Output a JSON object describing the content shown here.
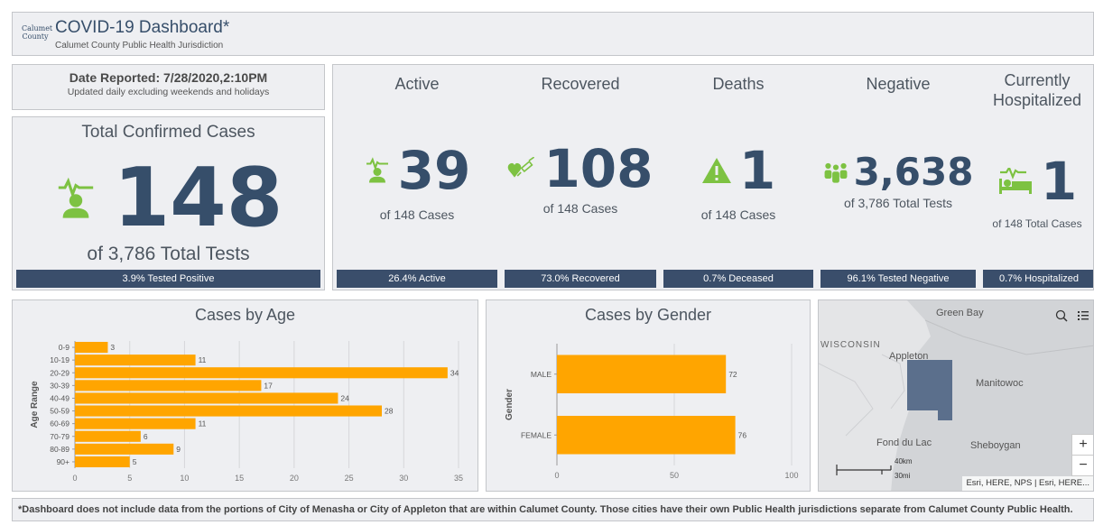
{
  "header": {
    "logo_line1": "Calumet",
    "logo_line2": "County",
    "title": "COVID-19 Dashboard*",
    "subtitle": "Calumet County Public Health Jurisdiction"
  },
  "date_panel": {
    "date": "Date Reported: 7/28/2020,2:10PM",
    "note": "Updated daily excluding weekends and holidays"
  },
  "total": {
    "title": "Total Confirmed Cases",
    "value": "148",
    "sub": "of 3,786 Total Tests",
    "bar": "3.9% Tested Positive"
  },
  "indicators": [
    {
      "title": "Active",
      "value": "39",
      "sub": "of 148 Cases",
      "bar": "26.4% Active",
      "icon": "patient-icon"
    },
    {
      "title": "Recovered",
      "value": "108",
      "sub": "of 148 Cases",
      "bar": "73.0% Recovered",
      "icon": "heart-syringe-icon"
    },
    {
      "title": "Deaths",
      "value": "1",
      "sub": "of 148 Cases",
      "bar": "0.7% Deceased",
      "icon": "warning-icon"
    },
    {
      "title": "Negative",
      "value": "3,638",
      "sub": "of 3,786 Total Tests",
      "bar": "96.1% Tested Negative",
      "icon": "people-icon"
    },
    {
      "title": "Currently Hospitalized",
      "value": "1",
      "sub": "of 148 Total Cases",
      "bar": "0.7% Hospitalized",
      "icon": "hospital-bed-icon"
    }
  ],
  "colors": {
    "navy": "#364e6a",
    "green": "#7dc242",
    "bar_orange": "#ffa500",
    "panel": "#eeeff2",
    "map_county": "#5b6f8c"
  },
  "age_chart": {
    "title": "Cases by Age"
  },
  "gender_chart": {
    "title": "Cases by Gender"
  },
  "chart_data": [
    {
      "type": "bar",
      "orientation": "horizontal",
      "title": "Cases by Age",
      "ylabel": "Age Range",
      "xlabel": "",
      "categories": [
        "0-9",
        "10-19",
        "20-29",
        "30-39",
        "40-49",
        "50-59",
        "60-69",
        "70-79",
        "80-89",
        "90+"
      ],
      "values": [
        3,
        11,
        34,
        17,
        24,
        28,
        11,
        6,
        9,
        5
      ],
      "xlim": [
        0,
        35
      ],
      "xticks": [
        0,
        5,
        10,
        15,
        20,
        25,
        30,
        35
      ],
      "grid": true
    },
    {
      "type": "bar",
      "orientation": "horizontal",
      "title": "Cases by Gender",
      "ylabel": "Gender",
      "xlabel": "",
      "categories": [
        "MALE",
        "FEMALE"
      ],
      "values": [
        72,
        76
      ],
      "xlim": [
        0,
        100
      ],
      "xticks": [
        0,
        50,
        100
      ],
      "grid": true
    }
  ],
  "map": {
    "labels": [
      "Green Bay",
      "WISCONSIN",
      "Appleton",
      "Manitowoc",
      "Fond du Lac",
      "Sheboygan"
    ],
    "scale_km": "40km",
    "scale_mi": "30mi",
    "attribution": "Esri, HERE, NPS | Esri, HERE...",
    "zoom_in": "+",
    "zoom_out": "−"
  },
  "footer": {
    "note": "*Dashboard does not include data from the portions of City of Menasha or City of Appleton that are within Calumet County. Those cities have their own Public Health jurisdictions separate from Calumet County Public Health."
  }
}
